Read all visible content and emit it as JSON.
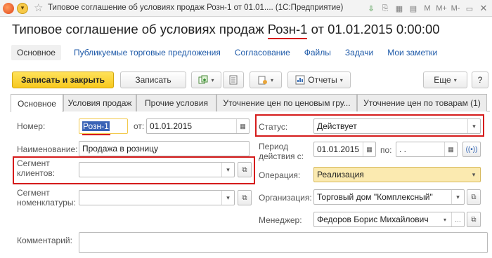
{
  "window": {
    "title": "Типовое соглашение об условиях продаж Розн-1 от 01.01.... (1С:Предприятие)",
    "titlebar_icons": [
      "app-icon",
      "menu-icon",
      "favorite-star-icon",
      "save-icon",
      "history-icon",
      "calculator-icon",
      "calendar-icon",
      "memory-m-icon",
      "memory-m-plus-icon",
      "memory-m-minus-icon",
      "restore-icon",
      "close-icon"
    ],
    "titlebar_glyphs": {
      "save": "⇩",
      "history": "⎘",
      "calculator": "▦",
      "calendar": "▤",
      "m": "M",
      "mplus": "M+",
      "mminus": "M-",
      "restore": "▭",
      "close": "✕",
      "star": "☆",
      "menu": "▾"
    }
  },
  "heading": {
    "prefix": "Типовое соглашение об условиях продаж ",
    "code": "Розн-1",
    "suffix": " от 01.01.2015 0:00:00"
  },
  "nav": {
    "active": "Основное",
    "links": [
      "Публикуемые торговые предложения",
      "Согласование",
      "Файлы",
      "Задачи",
      "Мои заметки"
    ]
  },
  "toolbar": {
    "save_close": "Записать и закрыть",
    "save": "Записать",
    "reports": "Отчеты",
    "more": "Еще",
    "help": "?",
    "icons": {
      "create_based": "create-based-icon",
      "document": "document-icon",
      "attach": "attach-icon",
      "reports": "reports-icon",
      "dropdown": "▾"
    }
  },
  "form_tabs": [
    "Основное",
    "Условия продаж",
    "Прочие условия",
    "Уточнение цен по ценовым гру...",
    "Уточнение цен по товарам (1)"
  ],
  "fields": {
    "number": {
      "label": "Номер:",
      "value": "Розн-1"
    },
    "date_from": {
      "label": "от:",
      "value": "01.01.2015"
    },
    "name": {
      "label": "Наименование:",
      "value": "Продажа в розницу"
    },
    "client_segment": {
      "label": "Сегмент клиентов:",
      "value": ""
    },
    "nomenclature_segment": {
      "label": "Сегмент номенклатуры:",
      "value": ""
    },
    "comment": {
      "label": "Комментарий:",
      "value": ""
    },
    "status": {
      "label": "Статус:",
      "value": "Действует"
    },
    "period": {
      "label": "Период действия с:",
      "from": "01.01.2015",
      "to_label": "по:",
      "to": " .  ."
    },
    "operation": {
      "label": "Операция:",
      "value": "Реализация"
    },
    "organization": {
      "label": "Организация:",
      "value": "Торговый дом \"Комплексный\""
    },
    "manager": {
      "label": "Менеджер:",
      "value": "Федоров Борис Михайлович"
    }
  },
  "colors": {
    "accent_red": "#d51b1b",
    "primary_button": "#f7c81e",
    "link": "#1d59a8",
    "selection": "#3a63b6",
    "operation_field": "#fbeab0"
  }
}
